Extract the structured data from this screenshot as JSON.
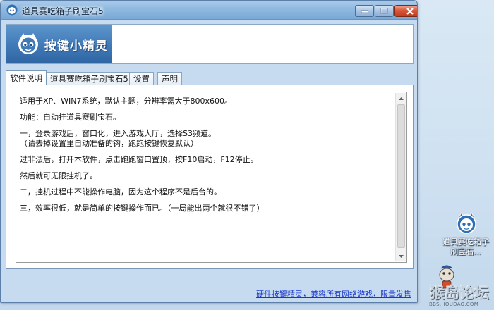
{
  "window": {
    "title": "道具赛吃箱子刷宝石5",
    "controls": {
      "minimize": "minimize",
      "maximize": "maximize",
      "close": "close"
    }
  },
  "banner": {
    "brand": "按键小精灵"
  },
  "tabs": [
    {
      "label": "软件说明",
      "active": true
    },
    {
      "label": "道具赛吃箱子刷宝石5",
      "active": false
    },
    {
      "label": "设置",
      "active": false
    },
    {
      "label": "声明",
      "active": false
    }
  ],
  "description": {
    "lines": [
      "适用于XP、WIN7系统，默认主题，分辨率需大于800x600。",
      "功能：自动挂道具赛刷宝石。",
      "一，登录游戏后，窗口化，进入游戏大厅，选择S3频道。",
      "（请去掉设置里自动准备的钩，跑跑按键恢复默认）",
      "过非法后，打开本软件，点击跑跑窗口置顶，按F10启动，F12停止。",
      "然后就可无限挂机了。",
      "二，挂机过程中不能操作电脑，因为这个程序不是后台的。",
      "三，效率很低，就是简单的按键操作而已。（一局能出两个就很不错了）"
    ]
  },
  "footer": {
    "link": "硬件按键精灵，兼容所有网络游戏，限量发售"
  },
  "desktop": {
    "icon_label_line1": "道具赛吃箱子",
    "icon_label_line2": "刷宝石..."
  },
  "watermark": {
    "text": "猴岛论坛",
    "url": "BBS.HOUDAO.COM"
  },
  "colors": {
    "titlebar": "#8fb9e0",
    "banner_logo": "#3f79b6",
    "link": "#1a38c8",
    "close_button": "#d9573b"
  }
}
